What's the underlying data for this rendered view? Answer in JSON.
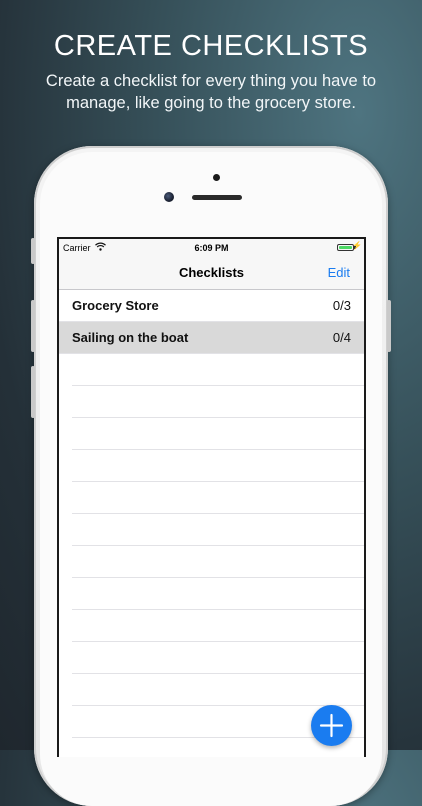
{
  "promo": {
    "headline": "CREATE CHECKLISTS",
    "subline": "Create a checklist for every thing you have to manage, like going to the grocery store."
  },
  "status_bar": {
    "carrier": "Carrier",
    "wifi_icon": "wifi-icon",
    "time": "6:09 PM",
    "battery_icon": "battery-icon",
    "battery_color": "#4cd964"
  },
  "nav": {
    "title": "Checklists",
    "edit_label": "Edit"
  },
  "checklists": [
    {
      "name": "Grocery Store",
      "progress": "0/3",
      "selected": false
    },
    {
      "name": "Sailing on the boat",
      "progress": "0/4",
      "selected": true
    }
  ],
  "fab": {
    "icon": "plus-icon",
    "color": "#1a7cf0"
  },
  "colors": {
    "accent": "#1a7cf0",
    "selected_row": "#d9d9d9"
  }
}
